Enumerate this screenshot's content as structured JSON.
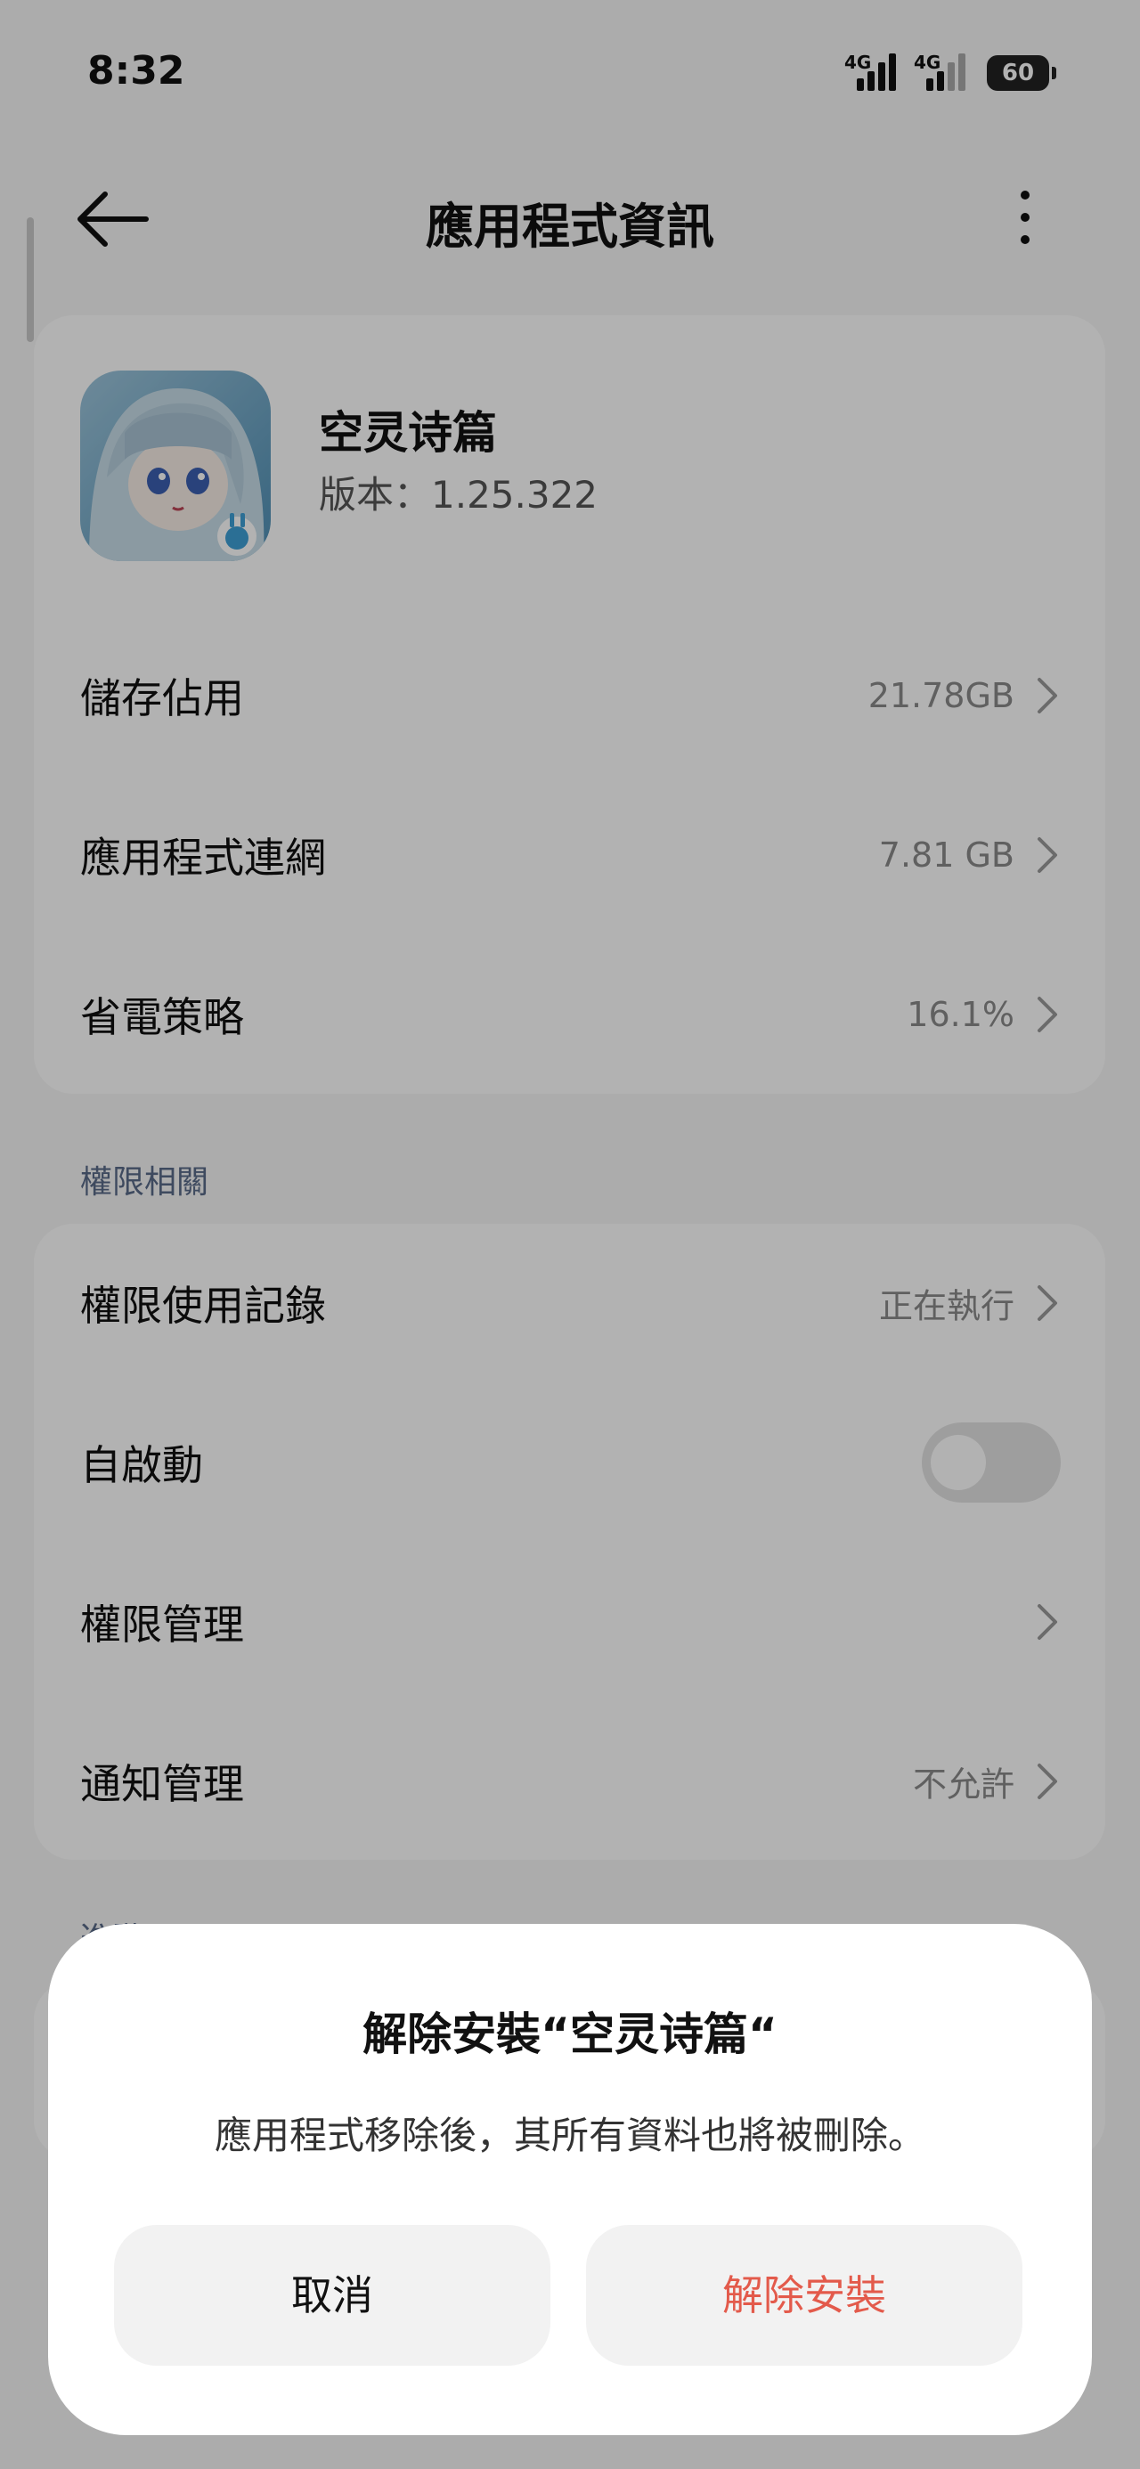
{
  "status_bar": {
    "time": "8:32",
    "signal_1_label": "4G",
    "signal_2_label": "4G",
    "battery": "60"
  },
  "header": {
    "title": "應用程式資訊",
    "back_icon": "arrow-left-icon",
    "more_icon": "more-vertical-icon"
  },
  "app": {
    "name": "空灵诗篇",
    "version": "版本：1.25.322"
  },
  "usage_rows": [
    {
      "label": "儲存佔用",
      "value": "21.78GB"
    },
    {
      "label": "應用程式連網",
      "value": "7.81 GB"
    },
    {
      "label": "省電策略",
      "value": "16.1%"
    }
  ],
  "permissions": {
    "section_title": "權限相關",
    "rows": [
      {
        "label": "權限使用記錄",
        "value": "正在執行"
      },
      {
        "label": "自啟動",
        "toggle_on": false
      },
      {
        "label": "權限管理",
        "value": ""
      },
      {
        "label": "通知管理",
        "value": "不允許"
      }
    ]
  },
  "next_section_partial": "進階",
  "dialog": {
    "title": "解除安裝“空灵诗篇“",
    "message": "應用程式移除後，其所有資料也將被刪除。",
    "cancel_label": "取消",
    "confirm_label": "解除安裝",
    "confirm_color": "#e35a4b"
  },
  "colors": {
    "background": "#f7f7f7",
    "card": "#ffffff",
    "section_title": "#5a6a88",
    "scrim": "rgba(0,0,0,0.3)"
  }
}
